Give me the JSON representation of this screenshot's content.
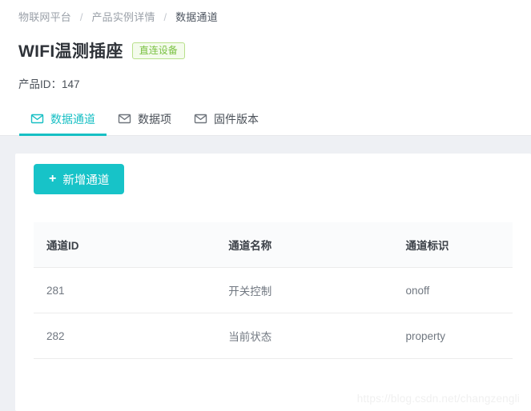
{
  "breadcrumb": {
    "separator": "/",
    "items": [
      {
        "label": "物联网平台",
        "current": false
      },
      {
        "label": "产品实例详情",
        "current": false
      },
      {
        "label": "数据通道",
        "current": true
      }
    ]
  },
  "header": {
    "title": "WIFI温测插座",
    "badge": "直连设备",
    "badge_color": "#7ac143",
    "badge_bg": "#f4fbec",
    "badge_border": "#b8e08a",
    "product_id_label": "产品ID：147"
  },
  "tabs": {
    "accent_color": "#17bfc4",
    "items": [
      {
        "label": "数据通道",
        "icon": "envelope-icon",
        "active": true
      },
      {
        "label": "数据项",
        "icon": "envelope-icon",
        "active": false
      },
      {
        "label": "固件版本",
        "icon": "envelope-icon",
        "active": false
      }
    ]
  },
  "toolbar": {
    "add_channel_label": "新增通道",
    "add_channel_icon": "plus-icon",
    "add_channel_color": "#17c3c8"
  },
  "table": {
    "columns": [
      "通道ID",
      "通道名称",
      "通道标识"
    ],
    "rows": [
      {
        "id": "281",
        "name": "开关控制",
        "key": "onoff"
      },
      {
        "id": "282",
        "name": "当前状态",
        "key": "property"
      }
    ]
  },
  "watermark": {
    "text": "https://blog.csdn.net/changzengli"
  }
}
